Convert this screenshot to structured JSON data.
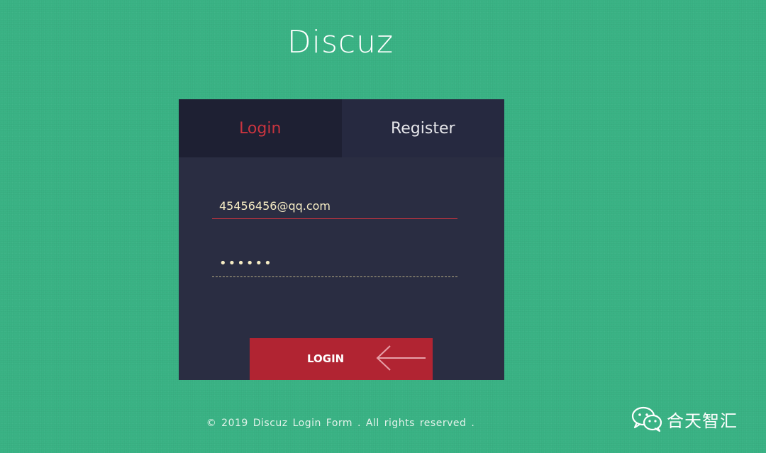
{
  "app": {
    "title": "Discuz"
  },
  "tabs": [
    {
      "label": "Login",
      "active": true
    },
    {
      "label": "Register",
      "active": false
    }
  ],
  "form": {
    "email_value": "45456456@qq.com",
    "password_value": "••••••"
  },
  "button": {
    "login_label": "LOGIN",
    "icon": "arrow-left-icon"
  },
  "footer": {
    "text": "© 2019 Discuz Login Form . All rights reserved ."
  },
  "watermark": {
    "icon": "wechat-icon",
    "text": "合天智汇"
  },
  "colors": {
    "background": "#3ab385",
    "panel": "#2a2d42",
    "active_tab_bg": "#1e2033",
    "accent_red": "#c8343f",
    "button_red": "#b12432",
    "input_text": "#f6ecc4"
  }
}
